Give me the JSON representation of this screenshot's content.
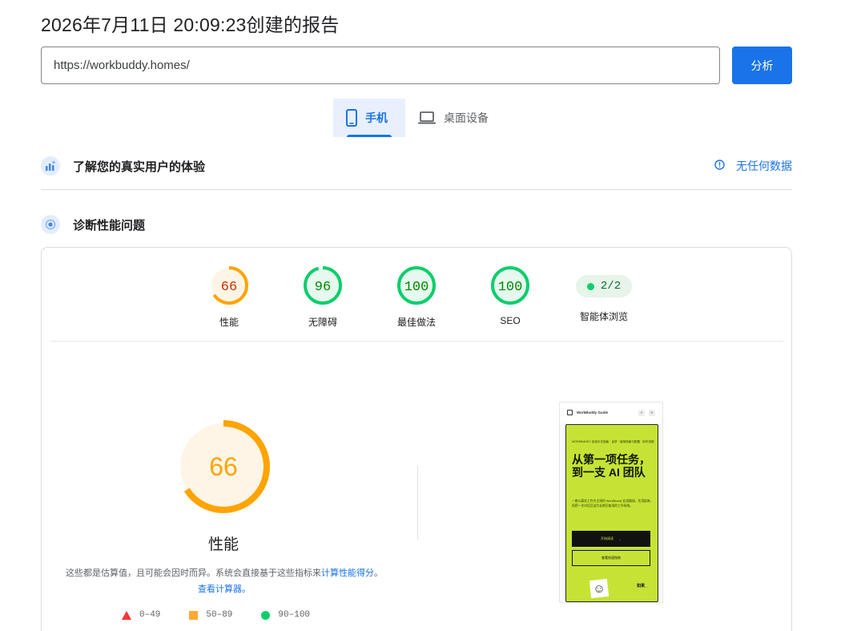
{
  "report": {
    "title": "2026年7月11日 20:09:23创建的报告"
  },
  "search": {
    "url_value": "https://workbuddy.homes/",
    "analyze_label": "分析"
  },
  "device_tabs": [
    {
      "label": "手机",
      "icon": "smartphone-icon",
      "active": true
    },
    {
      "label": "桌面设备",
      "icon": "laptop-icon",
      "active": false
    }
  ],
  "field_data": {
    "title": "了解您的真实用户的体验",
    "no_data_label": "无任何数据"
  },
  "diagnostics": {
    "title": "诊断性能问题"
  },
  "scores": [
    {
      "label": "性能",
      "value": "66",
      "fraction": 0.66,
      "rating": "average"
    },
    {
      "label": "无障碍",
      "value": "96",
      "fraction": 0.96,
      "rating": "pass"
    },
    {
      "label": "最佳做法",
      "value": "100",
      "fraction": 1.0,
      "rating": "pass"
    },
    {
      "label": "SEO",
      "value": "100",
      "fraction": 1.0,
      "rating": "pass"
    }
  ],
  "agent": {
    "value": "2/2",
    "label": "智能体浏览"
  },
  "performance": {
    "score": "66",
    "fraction": 0.66,
    "label": "性能",
    "desc_text": "这些都是估算值，且可能会因时而异。系统会直接基于这些指标来",
    "desc_link1": "计算性能得分",
    "desc_sep": "。",
    "desc_link2": "查看计算器。"
  },
  "legend": [
    {
      "shape": "triangle",
      "range": "0–49",
      "color": "#ff3333"
    },
    {
      "shape": "square",
      "range": "50–89",
      "color": "#ffaa33"
    },
    {
      "shape": "circle",
      "range": "90–100",
      "color": "#0cce6b"
    }
  ],
  "preview": {
    "brand": "WorkBuddy Guide",
    "tag": "WORKBUDDY 实用中文指南 · 自学 · 使用场景与配置 · 协作流程",
    "headline": "从第一项任务，到一支 AI 团队",
    "body": "一套以真实工作为主线的 WorkBuddy 实战路线。先用起来，再把一次对话沉淀为长期可复用的工作系统。",
    "primary_button": "开始阅读",
    "secondary_button": "查看快速指南",
    "footer_text": "如果_"
  },
  "colors": {
    "accent": "#1a73e8",
    "average": "#ffa400",
    "average_text": "#c33300",
    "pass": "#0cce6b",
    "pass_text": "#008800",
    "fail": "#ff3333"
  }
}
